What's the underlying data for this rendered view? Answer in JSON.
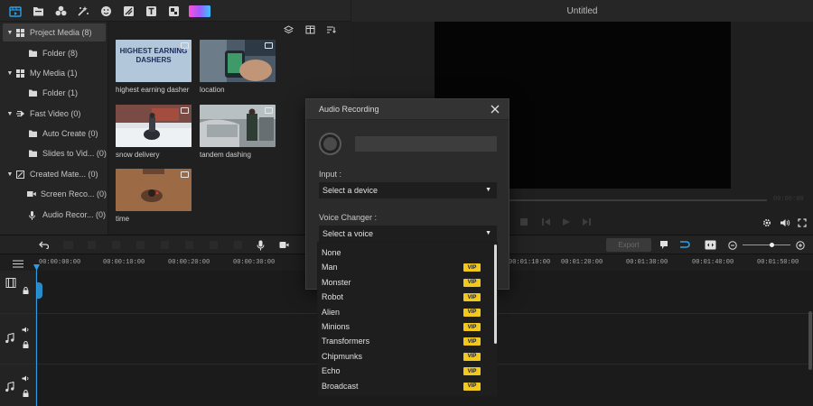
{
  "app": {
    "title": "Untitled"
  },
  "toolbar": {
    "icons": [
      "media-icon",
      "folder-icon",
      "audio-icon",
      "effects-icon",
      "sticker-icon",
      "transition-icon",
      "text-icon",
      "filter-icon",
      "gradient-icon"
    ]
  },
  "sidebar": {
    "items": [
      {
        "label": "Project Media (8)",
        "caret": "▼",
        "icon": "grid-icon"
      },
      {
        "label": "Folder (8)",
        "caret": "",
        "icon": "folder-icon"
      },
      {
        "label": "My Media (1)",
        "caret": "▼",
        "icon": "grid-icon"
      },
      {
        "label": "Folder (1)",
        "caret": "",
        "icon": "folder-icon"
      },
      {
        "label": "Fast Video (0)",
        "caret": "▼",
        "icon": "fast-icon"
      },
      {
        "label": "Auto Create (0)",
        "caret": "",
        "icon": "folder-icon"
      },
      {
        "label": "Slides to Vid... (0)",
        "caret": "",
        "icon": "folder-icon"
      },
      {
        "label": "Created Mate... (0)",
        "caret": "▼",
        "icon": "created-icon"
      },
      {
        "label": "Screen Reco... (0)",
        "caret": "",
        "icon": "screen-icon"
      },
      {
        "label": "Audio Recor... (0)",
        "caret": "",
        "icon": "mic-icon"
      }
    ]
  },
  "media": {
    "items": [
      {
        "label": "highest earning dasher",
        "overlay": "HIGHEST EARNING\nDASHERS"
      },
      {
        "label": "location",
        "overlay": ""
      },
      {
        "label": "snow delivery",
        "overlay": ""
      },
      {
        "label": "tandem dashing",
        "overlay": ""
      },
      {
        "label": "time",
        "overlay": ""
      }
    ]
  },
  "timeline": {
    "export_label": "Export",
    "ticks": [
      "00:00:00:00",
      "00:00:10:00",
      "00:00:20:00",
      "00:00:30:00",
      "00:01:10:00",
      "00:01:20:00",
      "00:01:30:00",
      "00:01:40:00",
      "00:01:50:00"
    ],
    "timecode": "00:00:00"
  },
  "dialog": {
    "title": "Audio Recording",
    "input_label": "Input :",
    "device_select": "Select a device",
    "voice_label": "Voice Changer :",
    "voice_select": "Select a voice",
    "vip_badge": "VIP",
    "voices": [
      {
        "label": "None",
        "vip": false
      },
      {
        "label": "Man",
        "vip": true
      },
      {
        "label": "Monster",
        "vip": true
      },
      {
        "label": "Robot",
        "vip": true
      },
      {
        "label": "Alien",
        "vip": true
      },
      {
        "label": "Minions",
        "vip": true
      },
      {
        "label": "Transformers",
        "vip": true
      },
      {
        "label": "Chipmunks",
        "vip": true
      },
      {
        "label": "Echo",
        "vip": true
      },
      {
        "label": "Broadcast",
        "vip": true
      }
    ]
  },
  "colors": {
    "accent": "#2b9fe6",
    "vip": "#f2c81c",
    "background": "#1e1e1e"
  }
}
